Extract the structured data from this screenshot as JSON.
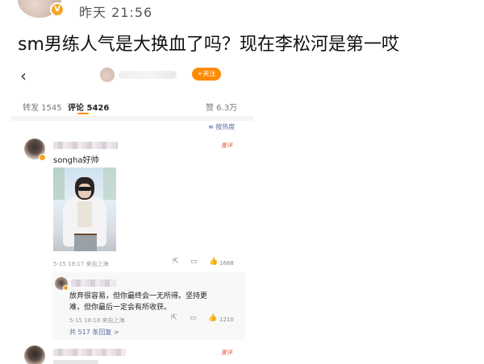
{
  "post": {
    "time": "昨天 21:56",
    "verified_mark": "V",
    "text": "sm男练人气是大换血了吗？现在李松河是第一哎"
  },
  "screenshot": {
    "nav": {
      "back_icon": "chevron-left-icon",
      "back_glyph": "‹",
      "follow_label": "+关注"
    },
    "tabs": {
      "forward_label": "转发 1545",
      "comments_label": "评论 5426",
      "likes_label": "赞 6.3万"
    },
    "sort_label": "≡ 按热度",
    "comments": [
      {
        "tag": "置评",
        "text": "songha好帅",
        "meta": "5-15 18:17 来自上海",
        "like_count": "1688",
        "reply": {
          "text": "放弃很容易，但你最终会一无所得。坚持更难，但你最后一定会有所收获。",
          "meta": "5-15 18:18 来自上海",
          "like_count": "1210"
        },
        "more_replies": "共 517 条回复 >"
      },
      {
        "tag": "置评"
      }
    ],
    "icons": {
      "share_glyph": "⇱",
      "reply_glyph": "▭",
      "like_glyph": "👍"
    }
  },
  "colors": {
    "accent_orange": "#ff8a00",
    "link_blue": "#5b6fa3",
    "verified_gold": "#f5a623",
    "tag_red": "#e0573a"
  }
}
